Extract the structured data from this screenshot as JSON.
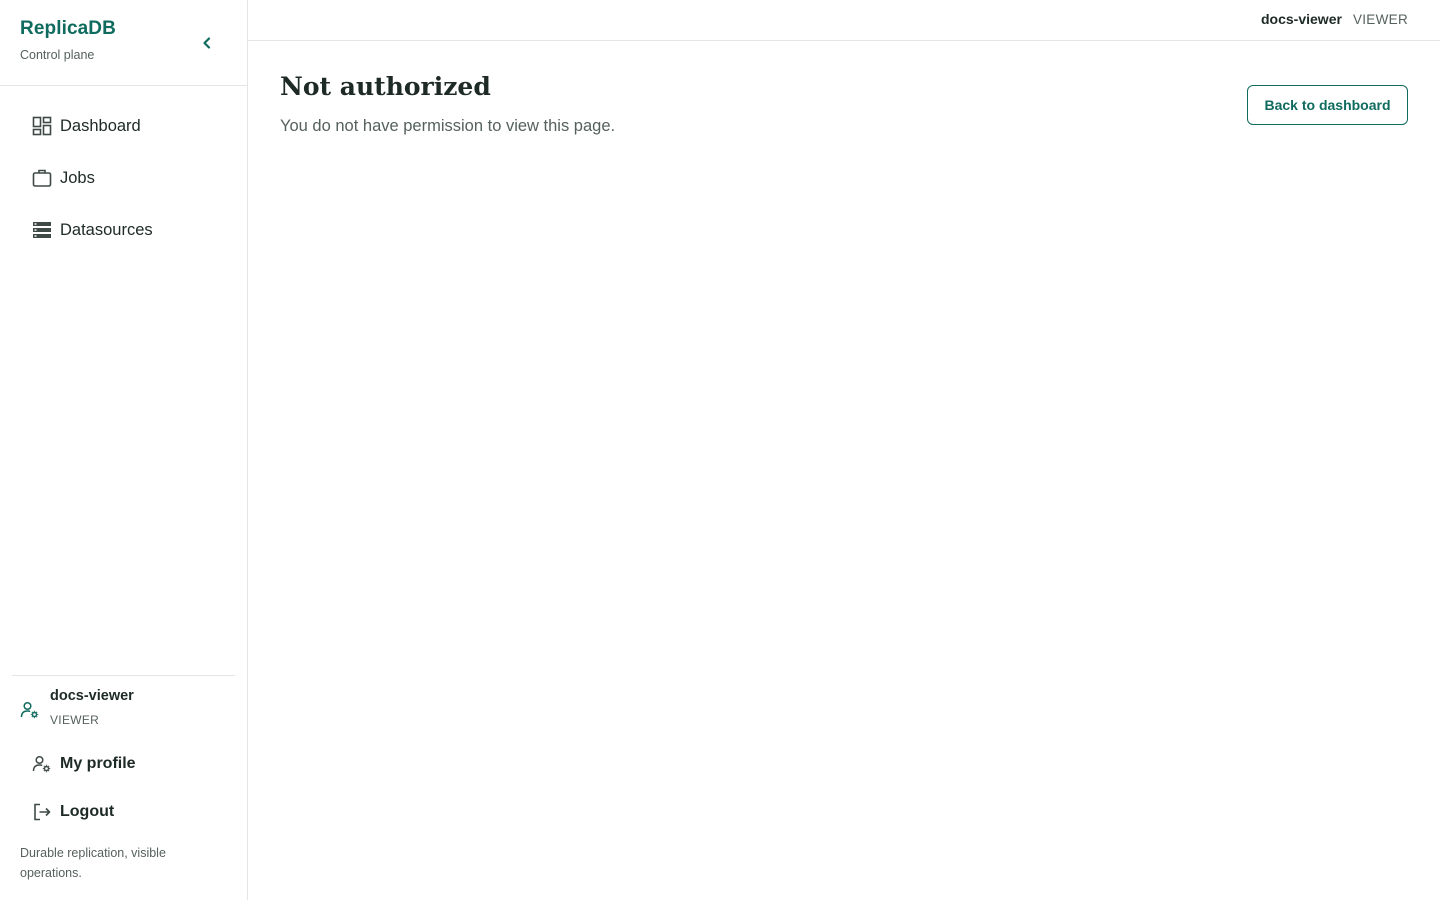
{
  "app": {
    "name": "ReplicaDB",
    "subtitle": "Control plane",
    "tagline": "Durable replication, visible operations."
  },
  "sidebar": {
    "collapse_icon": "chevron-left-icon",
    "nav": [
      {
        "label": "Dashboard",
        "icon": "dashboard-grid-icon"
      },
      {
        "label": "Jobs",
        "icon": "briefcase-icon"
      },
      {
        "label": "Datasources",
        "icon": "database-list-icon"
      }
    ],
    "user": {
      "name": "docs-viewer",
      "role": "VIEWER",
      "icon": "user-settings-icon"
    },
    "actions": {
      "profile_label": "My profile",
      "logout_label": "Logout"
    }
  },
  "topbar": {
    "user_name": "docs-viewer",
    "user_role": "VIEWER"
  },
  "main": {
    "title": "Not authorized",
    "message": "You do not have permission to view this page.",
    "back_button_label": "Back to dashboard"
  },
  "colors": {
    "accent": "#0f6b5e",
    "text": "#1d2a25",
    "muted": "#55615c",
    "border": "#e3e6e4"
  }
}
